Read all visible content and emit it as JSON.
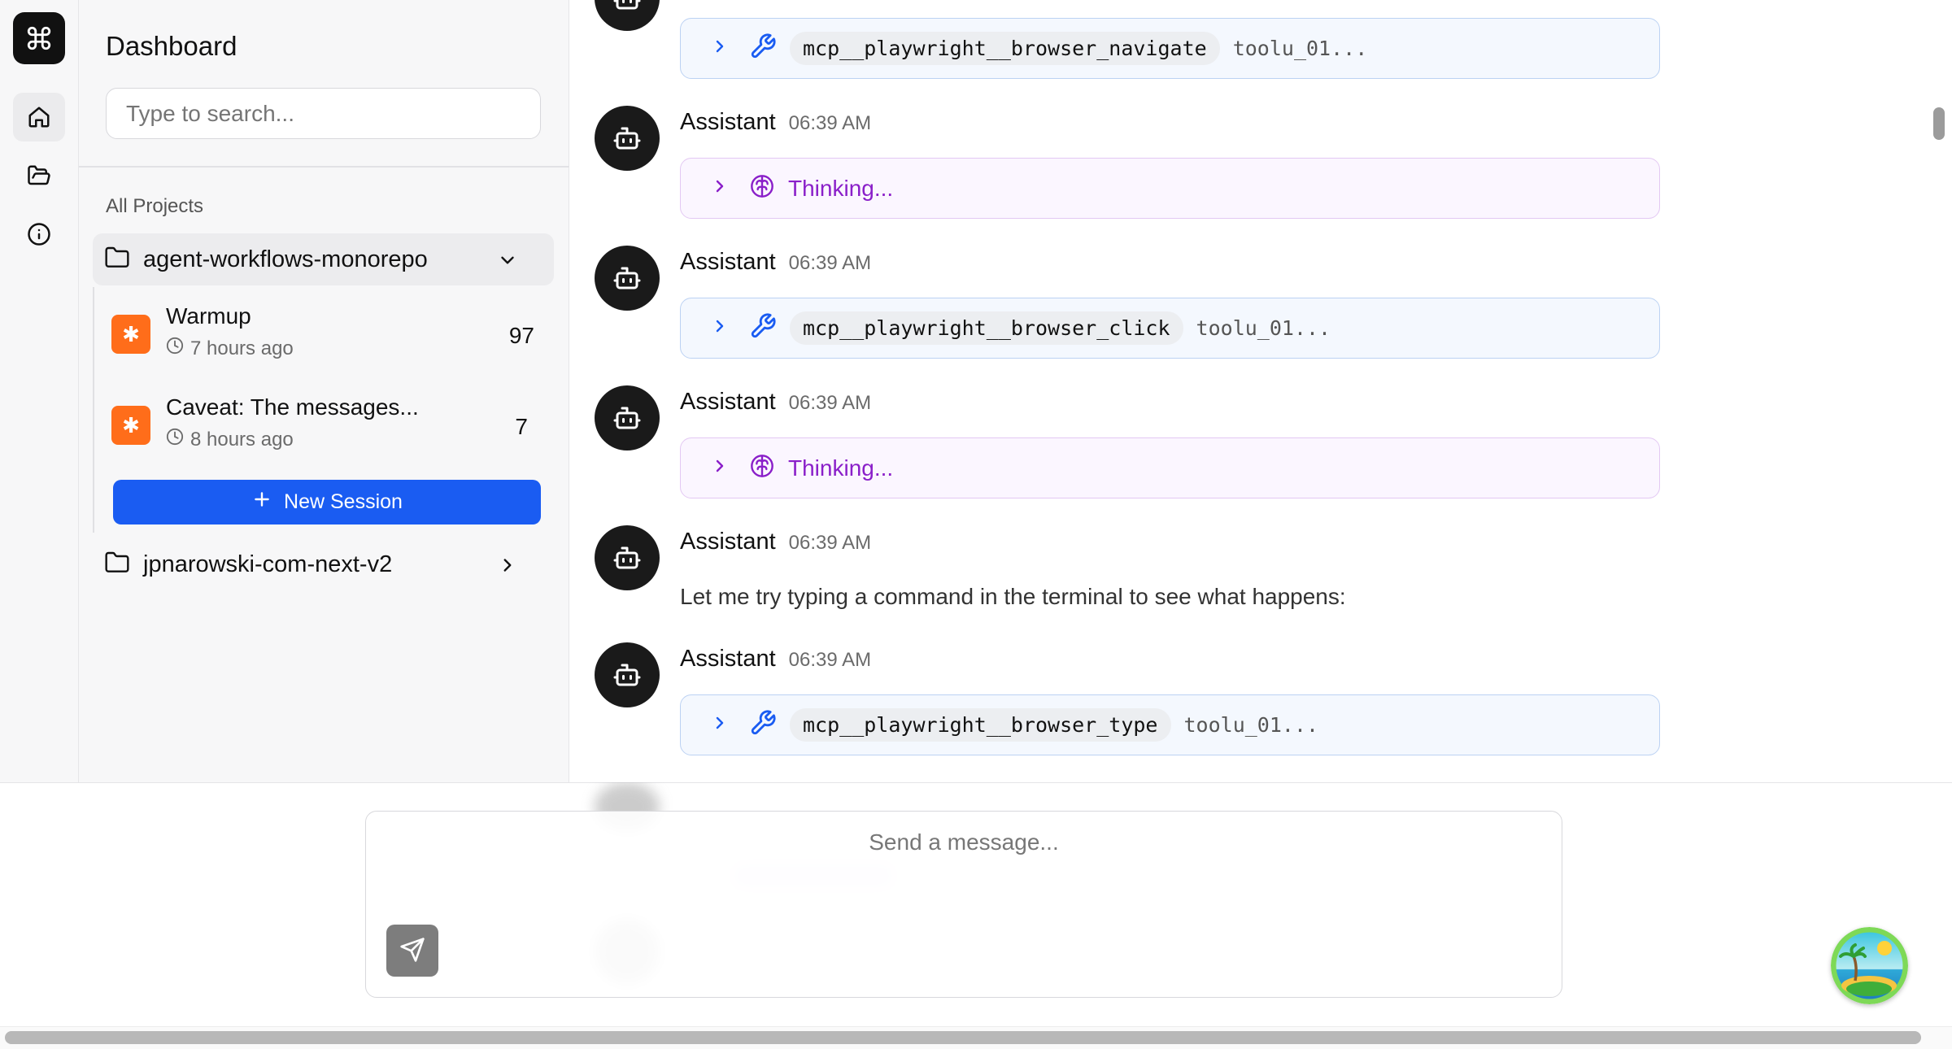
{
  "sidebar": {
    "title": "Dashboard",
    "search_placeholder": "Type to search...",
    "section_label": "All Projects",
    "projects": [
      {
        "name": "agent-workflows-monorepo",
        "expanded": true,
        "sessions": [
          {
            "title": "Warmup",
            "time": "7 hours ago",
            "count": "97"
          },
          {
            "title": "Caveat: The messages...",
            "time": "8 hours ago",
            "count": "7"
          }
        ],
        "new_session_label": "New Session"
      },
      {
        "name": "jpnarowski-com-next-v2",
        "expanded": false
      }
    ]
  },
  "rail": {
    "logo_icon": "command-icon",
    "items": [
      "home-icon",
      "folder-open-icon",
      "info-icon"
    ]
  },
  "messages": [
    {
      "type": "tool",
      "tool_name": "mcp__playwright__browser_navigate",
      "tool_id": "toolu_01..."
    },
    {
      "type": "thinking",
      "author": "Assistant",
      "time": "06:39 AM",
      "label": "Thinking..."
    },
    {
      "type": "tool",
      "author": "Assistant",
      "time": "06:39 AM",
      "tool_name": "mcp__playwright__browser_click",
      "tool_id": "toolu_01..."
    },
    {
      "type": "thinking",
      "author": "Assistant",
      "time": "06:39 AM",
      "label": "Thinking..."
    },
    {
      "type": "text",
      "author": "Assistant",
      "time": "06:39 AM",
      "text": "Let me try typing a command in the terminal to see what happens:"
    },
    {
      "type": "tool",
      "author": "Assistant",
      "time": "06:39 AM",
      "tool_name": "mcp__playwright__browser_type",
      "tool_id": "toolu_01..."
    }
  ],
  "composer": {
    "placeholder": "Send a message..."
  },
  "colors": {
    "primary": "#1a5cf2",
    "session_badge": "#ff6d1a",
    "thinking": "#8a1fc9",
    "tool_border": "#bcd2f3",
    "thinking_border": "#e3c8f3"
  }
}
